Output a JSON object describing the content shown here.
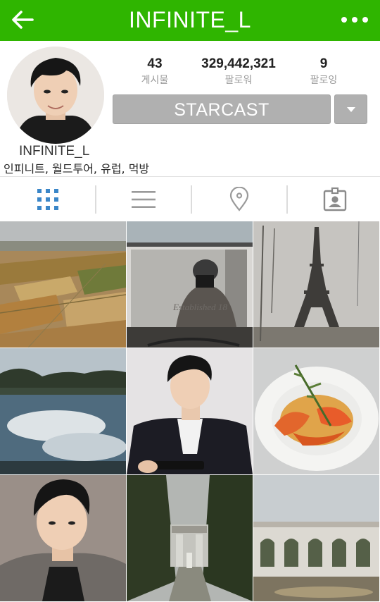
{
  "header": {
    "title": "INFINITE_L",
    "back_icon": "arrow-left-icon",
    "more_icon": "more-dots-icon",
    "color": "#2fb500"
  },
  "profile": {
    "username": "INFINITE_L",
    "bio": "인피니트, 월드투어, 유럽, 먹방",
    "stats": [
      {
        "value": "43",
        "label": "게시물"
      },
      {
        "value": "329,442,321",
        "label": "팔로워"
      },
      {
        "value": "9",
        "label": "팔로잉"
      }
    ],
    "starcast_label": "STARCAST"
  },
  "tabs": [
    {
      "icon": "grid-icon",
      "active": true
    },
    {
      "icon": "list-icon",
      "active": false
    },
    {
      "icon": "location-pin-icon",
      "active": false
    },
    {
      "icon": "tagged-person-icon",
      "active": false
    }
  ],
  "photos": [
    {
      "subject": "aerial-farmland"
    },
    {
      "subject": "mirror-selfie"
    },
    {
      "subject": "eiffel-tower"
    },
    {
      "subject": "lake-reflection"
    },
    {
      "subject": "man-with-phone"
    },
    {
      "subject": "shrimp-pasta"
    },
    {
      "subject": "selfie-hoodie"
    },
    {
      "subject": "garden-hedge-path"
    },
    {
      "subject": "colonnade-garden"
    }
  ],
  "photo_texts": {
    "shop_sign": "Established 18"
  }
}
